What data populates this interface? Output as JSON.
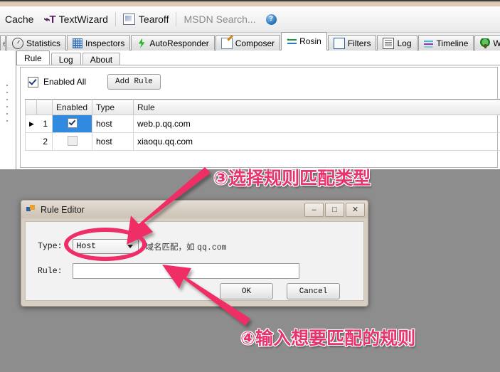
{
  "toolbar": {
    "items": [
      {
        "label": "Cache",
        "icon": "cache-icon",
        "muted": false
      },
      {
        "label": "TextWizard",
        "icon": "textwizard-icon",
        "muted": false
      },
      {
        "label": "Tearoff",
        "icon": "tearoff-icon",
        "muted": false
      },
      {
        "label": "MSDN Search...",
        "icon": "msdn-search-icon",
        "muted": true
      }
    ],
    "help_icon_label": "?"
  },
  "tabs": {
    "edge_label": "e",
    "items": [
      {
        "label": "Statistics",
        "icon": "statistics-icon",
        "active": false
      },
      {
        "label": "Inspectors",
        "icon": "inspectors-icon",
        "active": false
      },
      {
        "label": "AutoResponder",
        "icon": "autoresponder-icon",
        "active": false
      },
      {
        "label": "Composer",
        "icon": "composer-icon",
        "active": false
      },
      {
        "label": "Rosin",
        "icon": "rosin-icon",
        "active": true
      },
      {
        "label": "Filters",
        "icon": "filters-icon",
        "active": false
      },
      {
        "label": "Log",
        "icon": "log-icon",
        "active": false
      },
      {
        "label": "Timeline",
        "icon": "timeline-icon",
        "active": false
      },
      {
        "label": "Willow",
        "icon": "willow-icon",
        "active": false
      }
    ]
  },
  "subtabs": [
    {
      "label": "Rule",
      "active": true
    },
    {
      "label": "Log",
      "active": false
    },
    {
      "label": "About",
      "active": false
    }
  ],
  "panel": {
    "enabled_all_label": "Enabled All",
    "enabled_all_checked": true,
    "add_rule_label": "Add Rule"
  },
  "table": {
    "headers": [
      "",
      "",
      "Enabled",
      "Type",
      "Rule"
    ],
    "rows": [
      {
        "marker": "▶",
        "num": "1",
        "enabled": true,
        "type": "host",
        "rule": "web.p.qq.com",
        "selected": true
      },
      {
        "marker": "",
        "num": "2",
        "enabled": false,
        "type": "host",
        "rule": "xiaoqu.qq.com",
        "selected": false
      }
    ]
  },
  "dialog": {
    "title": "Rule Editor",
    "minimize_label": "–",
    "maximize_label": "□",
    "close_label": "✕",
    "type_label": "Type:",
    "type_value": "Host",
    "type_options": [
      "Host"
    ],
    "type_hint": "域名匹配，如",
    "type_hint_example": "qq.com",
    "rule_label": "Rule:",
    "rule_value": "",
    "ok_label": "OK",
    "cancel_label": "Cancel"
  },
  "annotations": [
    {
      "id": "anno-3",
      "text": "③选择规则匹配类型"
    },
    {
      "id": "anno-4",
      "text": "④输入想要匹配的规则"
    }
  ],
  "colors": {
    "annotation": "#ef2d66",
    "selection": "#2f8ae0",
    "desktop": "#8d8d8d"
  }
}
